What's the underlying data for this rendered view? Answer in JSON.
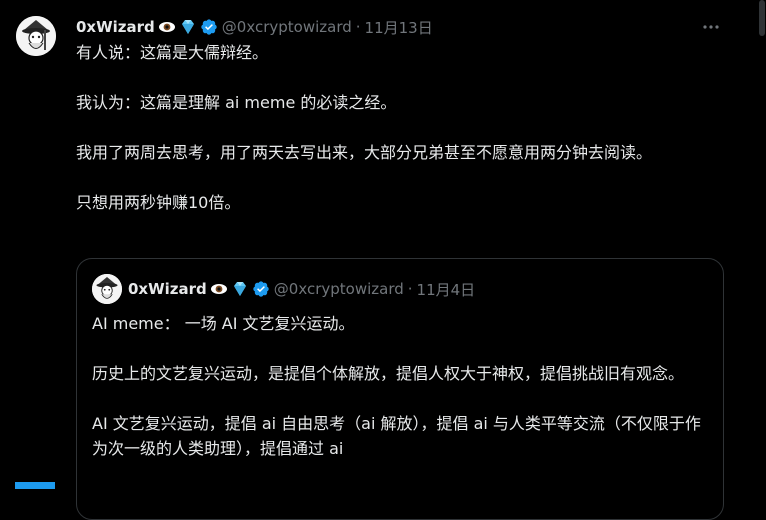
{
  "tweet": {
    "author_name": "0xWizard",
    "handle": "@0xcryptowizard",
    "separator": "·",
    "time": "11月13日",
    "lines": [
      "有人说：这篇是大儒辩经。",
      "我认为：这篇是理解 ai meme 的必读之经。",
      "我用了两周去思考，用了两天去写出来，大部分兄弟甚至不愿意用两分钟去阅读。",
      "只想用两秒钟赚10倍。"
    ]
  },
  "quoted": {
    "author_name": "0xWizard",
    "handle": "@0xcryptowizard",
    "separator": "·",
    "time": "11月4日",
    "lines": [
      "AI meme：  一场 AI 文艺复兴运动。",
      "历史上的文艺复兴运动，是提倡个体解放，提倡人权大于神权，提倡挑战旧有观念。",
      "AI 文艺复兴运动，提倡 ai 自由思考（ai 解放），提倡 ai 与人类平等交流（不仅限于作为次一级的人类助理），提倡通过 ai"
    ]
  },
  "icons": {
    "eye": "eye-emoji-icon",
    "gem": "gem-emoji-icon",
    "verified": "verified-badge-icon",
    "more": "more-options-icon"
  },
  "colors": {
    "background": "#000000",
    "text": "#e7e9ea",
    "muted": "#71767b",
    "verified": "#1d9bf0",
    "border": "#2f3336"
  }
}
